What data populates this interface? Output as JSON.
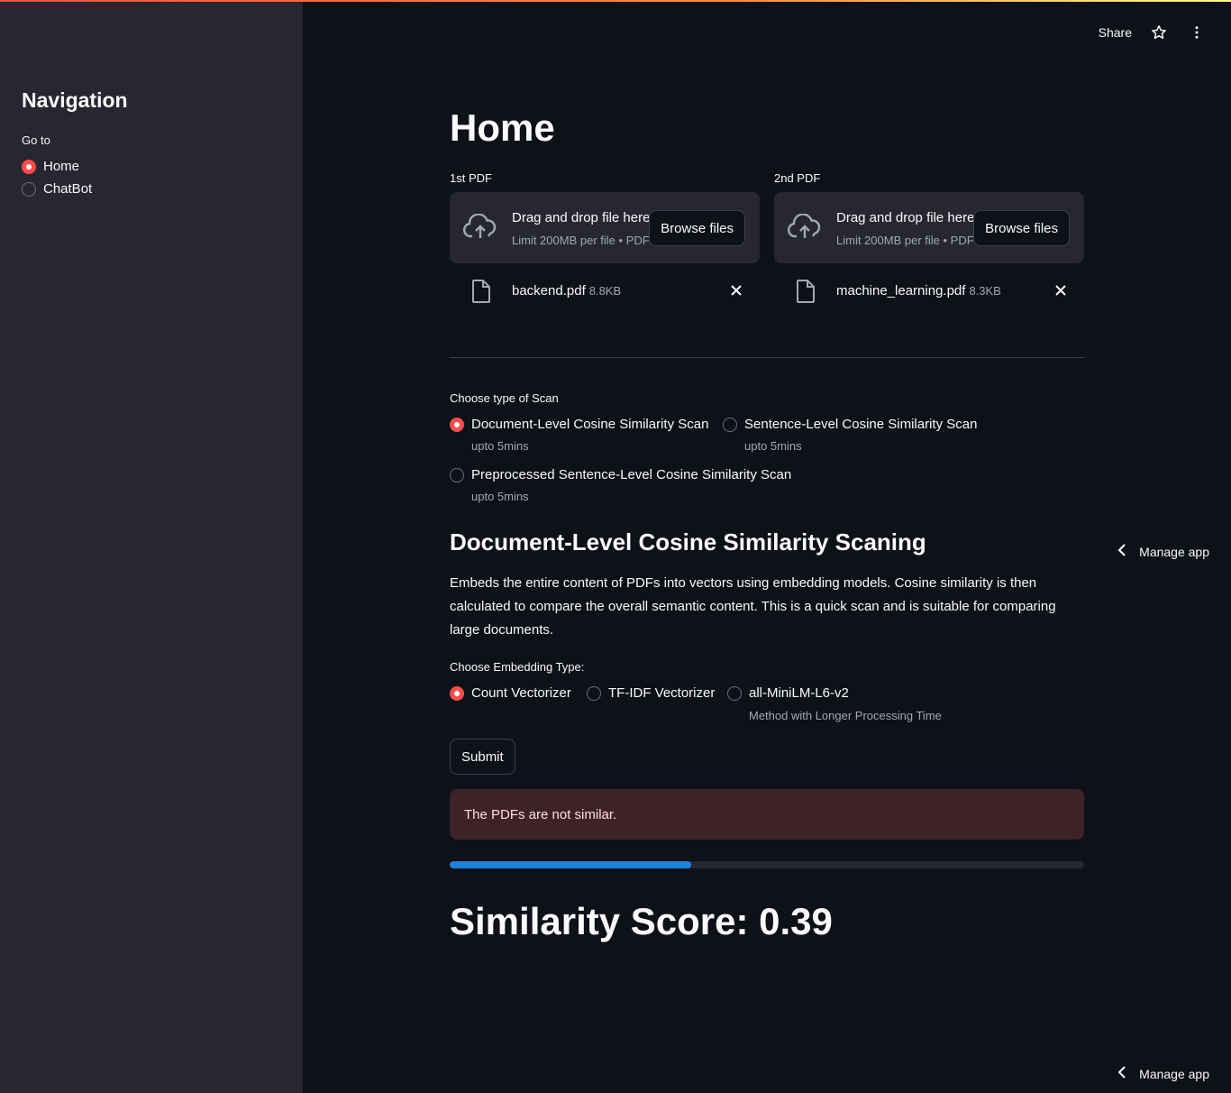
{
  "sidebar": {
    "title": "Navigation",
    "goto_label": "Go to",
    "options": [
      {
        "label": "Home",
        "selected": true
      },
      {
        "label": "ChatBot",
        "selected": false
      }
    ]
  },
  "header": {
    "share_label": "Share",
    "star_icon": "star-icon",
    "menu_icon": "more-vertical-icon"
  },
  "main": {
    "title": "Home",
    "uploaders": [
      {
        "label": "1st PDF",
        "drop_title": "Drag and drop file here",
        "limit": "Limit 200MB per file • PDF",
        "browse_label": "Browse files",
        "file_name": "backend.pdf",
        "file_size": "8.8KB"
      },
      {
        "label": "2nd PDF",
        "drop_title": "Drag and drop file here",
        "limit": "Limit 200MB per file • PDF",
        "browse_label": "Browse files",
        "file_name": "machine_learning.pdf",
        "file_size": "8.3KB"
      }
    ],
    "scan_type": {
      "label": "Choose type of Scan",
      "options": [
        {
          "label": "Document-Level Cosine Similarity Scan",
          "help": "upto 5mins",
          "selected": true
        },
        {
          "label": "Sentence-Level Cosine Similarity Scan",
          "help": "upto 5mins",
          "selected": false
        },
        {
          "label": "Preprocessed Sentence-Level Cosine Similarity Scan",
          "help": "upto 5mins",
          "selected": false
        }
      ]
    },
    "section_title": "Document-Level Cosine Similarity Scaning",
    "description": "Embeds the entire content of PDFs into vectors using embedding models. Cosine similarity is then calculated to compare the overall semantic content. This is a quick scan and is suitable for comparing large documents.",
    "embedding": {
      "label": "Choose Embedding Type:",
      "options": [
        {
          "label": "Count Vectorizer",
          "selected": true
        },
        {
          "label": "TF-IDF Vectorizer",
          "selected": false
        },
        {
          "label": "all-MiniLM-L6-v2",
          "help": "Method with Longer Processing Time",
          "selected": false
        }
      ]
    },
    "submit_label": "Submit",
    "alert_text": "The PDFs are not similar.",
    "progress": 0.38,
    "score_text": "Similarity Score: 0.39"
  },
  "manage_app_label": "Manage app",
  "colors": {
    "accent": "#ff4b4b",
    "progress": "#1c83e1",
    "background": "#0e1117",
    "sidebar": "#262730",
    "alert_bg": "#3e2228"
  }
}
